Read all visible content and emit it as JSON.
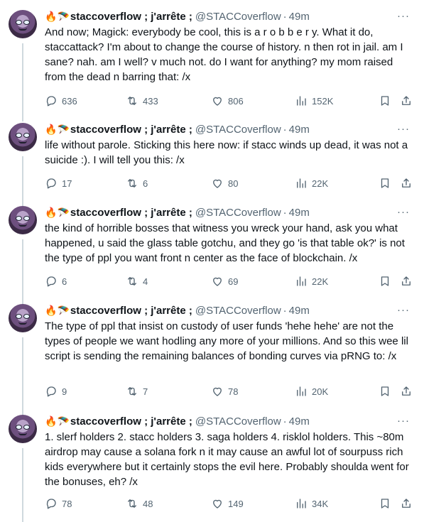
{
  "author": {
    "display_name": "staccoverflow ; j'arrête ;",
    "handle": "@STACCoverflow",
    "emoji_fire": "🔥",
    "emoji_parachute": "🪂",
    "avatar_icon": "avatar-icon"
  },
  "separator": "·",
  "more_label": "···",
  "tweets": [
    {
      "time": "49m",
      "text": "And now; Magick: everybody be cool, this is a r o b b e r y. What it do, staccattack? I'm about to change the course of history. n then rot in jail. am I sane? nah. am I well? v much not. do I want for anything? my mom raised from the dead n barring that: /x",
      "replies": "636",
      "reposts": "433",
      "likes": "806",
      "views": "152K"
    },
    {
      "time": "49m",
      "text": "life without parole. Sticking this here now: if stacc winds up dead, it was not a suicide :). I will tell you this: /x",
      "replies": "17",
      "reposts": "6",
      "likes": "80",
      "views": "22K"
    },
    {
      "time": "49m",
      "text": "the kind of horrible bosses that witness you wreck your hand, ask you what happened, u said the glass table gotchu, and they go 'is that table ok?' is not the type of ppl you want front n center as the face of blockchain. /x",
      "replies": "6",
      "reposts": "4",
      "likes": "69",
      "views": "22K"
    },
    {
      "time": "49m",
      "text": "The type of ppl that insist on custody of user funds 'hehe hehe' are not the types of people we want hodling any more of your millions. And so this wee lil script is sending the remaining balances of bonding curves via pRNG to: /x",
      "replies": "9",
      "reposts": "7",
      "likes": "78",
      "views": "20K"
    },
    {
      "time": "49m",
      "text": "1. slerf holders 2. stacc holders 3. saga holders 4. risklol holders. This ~80m airdrop may cause a solana fork n it may cause an awful lot of sourpuss rich kids everywhere but it certainly stops the evil here. Probably shoulda went for the bonuses, eh? /x",
      "replies": "78",
      "reposts": "48",
      "likes": "149",
      "views": "34K"
    }
  ]
}
